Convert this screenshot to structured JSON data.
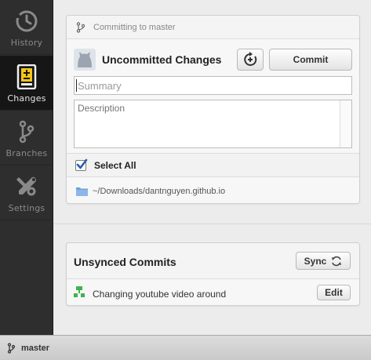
{
  "sidebar": {
    "items": [
      {
        "label": "History",
        "icon": "history-icon"
      },
      {
        "label": "Changes",
        "icon": "changes-icon",
        "active": true
      },
      {
        "label": "Branches",
        "icon": "branches-icon"
      },
      {
        "label": "Settings",
        "icon": "settings-icon"
      }
    ]
  },
  "commit_panel": {
    "header": "Committing to master",
    "title": "Uncommitted Changes",
    "commit_label": "Commit",
    "summary_placeholder": "Summary",
    "description_placeholder": "Description",
    "select_all_label": "Select All",
    "select_all_checked": true,
    "repo_path": "~/Downloads/dantnguyen.github.io"
  },
  "unsynced": {
    "title": "Unsynced Commits",
    "sync_label": "Sync",
    "commits": [
      {
        "message": "Changing youtube video around",
        "edit_label": "Edit"
      }
    ]
  },
  "footer": {
    "branch": "master"
  },
  "colors": {
    "sidebar_bg": "#2e2e2e",
    "sidebar_active_bg": "#161616",
    "accent_yellow": "#f5c518",
    "check_blue": "#2a5db0",
    "commit_green": "#3fb34f",
    "folder_blue": "#6fa0d8"
  }
}
